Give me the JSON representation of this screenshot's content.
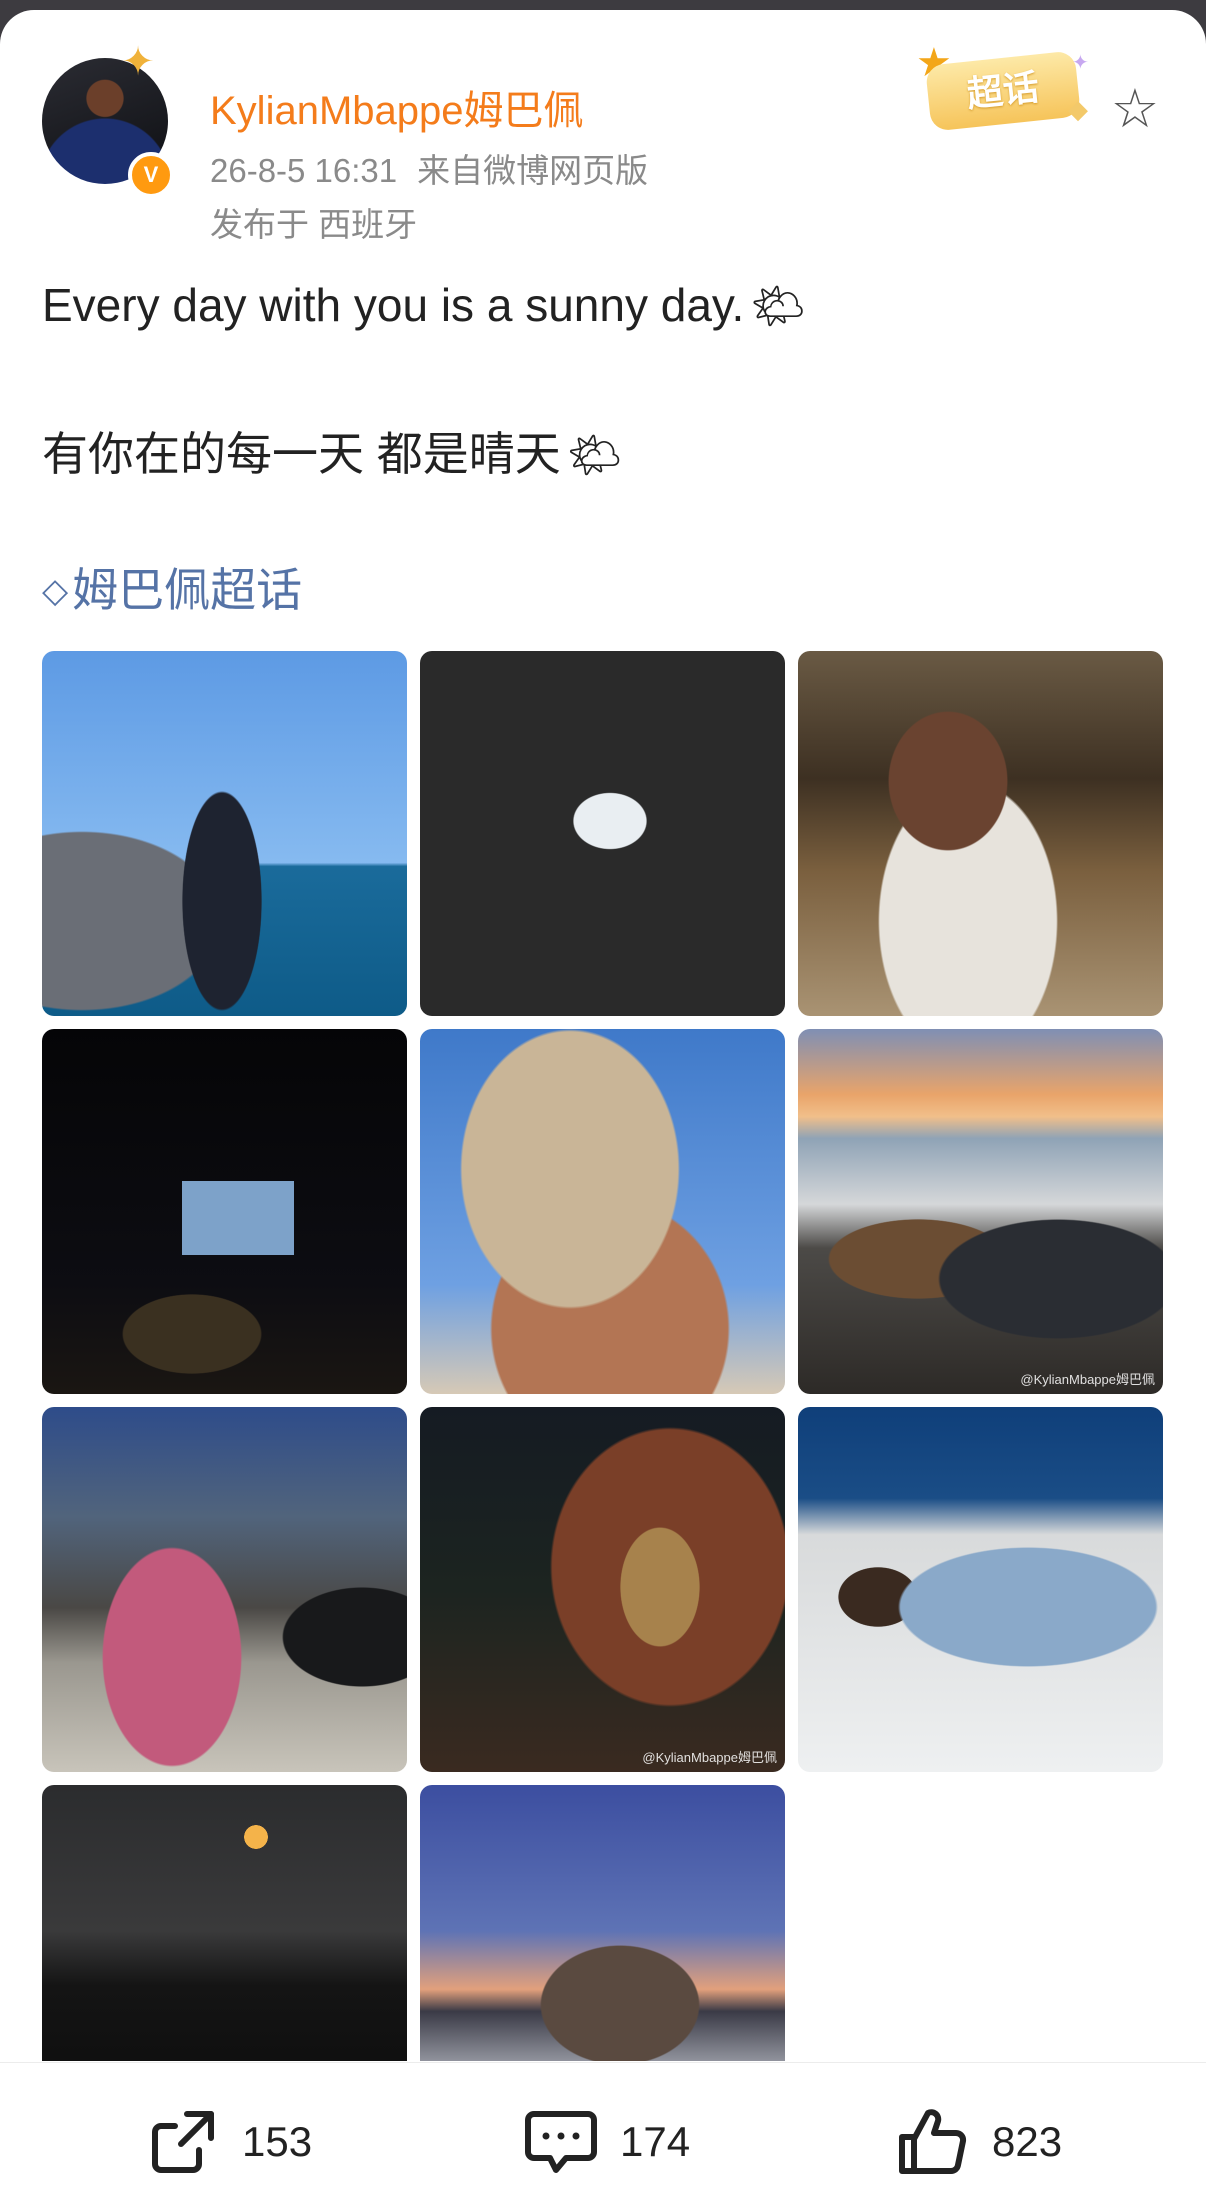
{
  "post": {
    "username": "KylianMbappe姆巴佩",
    "timestamp": "26-8-5 16:31",
    "source": "来自微博网页版",
    "location": "发布于 西班牙",
    "badge": "超话",
    "text_en": "Every day with you is a sunny day.",
    "text_zh": "有你在的每一天 都是晴天",
    "emoji": "🌤",
    "topic": "姆巴佩超话",
    "watermark": "@KylianMbappe姆巴佩"
  },
  "photos": [
    {
      "name": "yacht-sea-standing"
    },
    {
      "name": "snorkeling"
    },
    {
      "name": "shop-dresses"
    },
    {
      "name": "outdoor-cinema-night"
    },
    {
      "name": "towel-phone-selfie"
    },
    {
      "name": "sunset-dinner-table"
    },
    {
      "name": "street-drink"
    },
    {
      "name": "palm-trees-night"
    },
    {
      "name": "boat-deck-resting"
    },
    {
      "name": "moon-night-hills"
    },
    {
      "name": "yacht-dusk-seated"
    }
  ],
  "actions": {
    "repost_count": "153",
    "comment_count": "174",
    "like_count": "823"
  },
  "icons": {
    "star": "star-outline-icon",
    "repost": "share-arrow-icon",
    "comment": "speech-bubble-icon",
    "like": "thumbs-up-icon"
  },
  "colors": {
    "username": "#f47c1b",
    "topic": "#5573a6",
    "meta": "#8a8a8a",
    "verified": "#ff9a10"
  }
}
